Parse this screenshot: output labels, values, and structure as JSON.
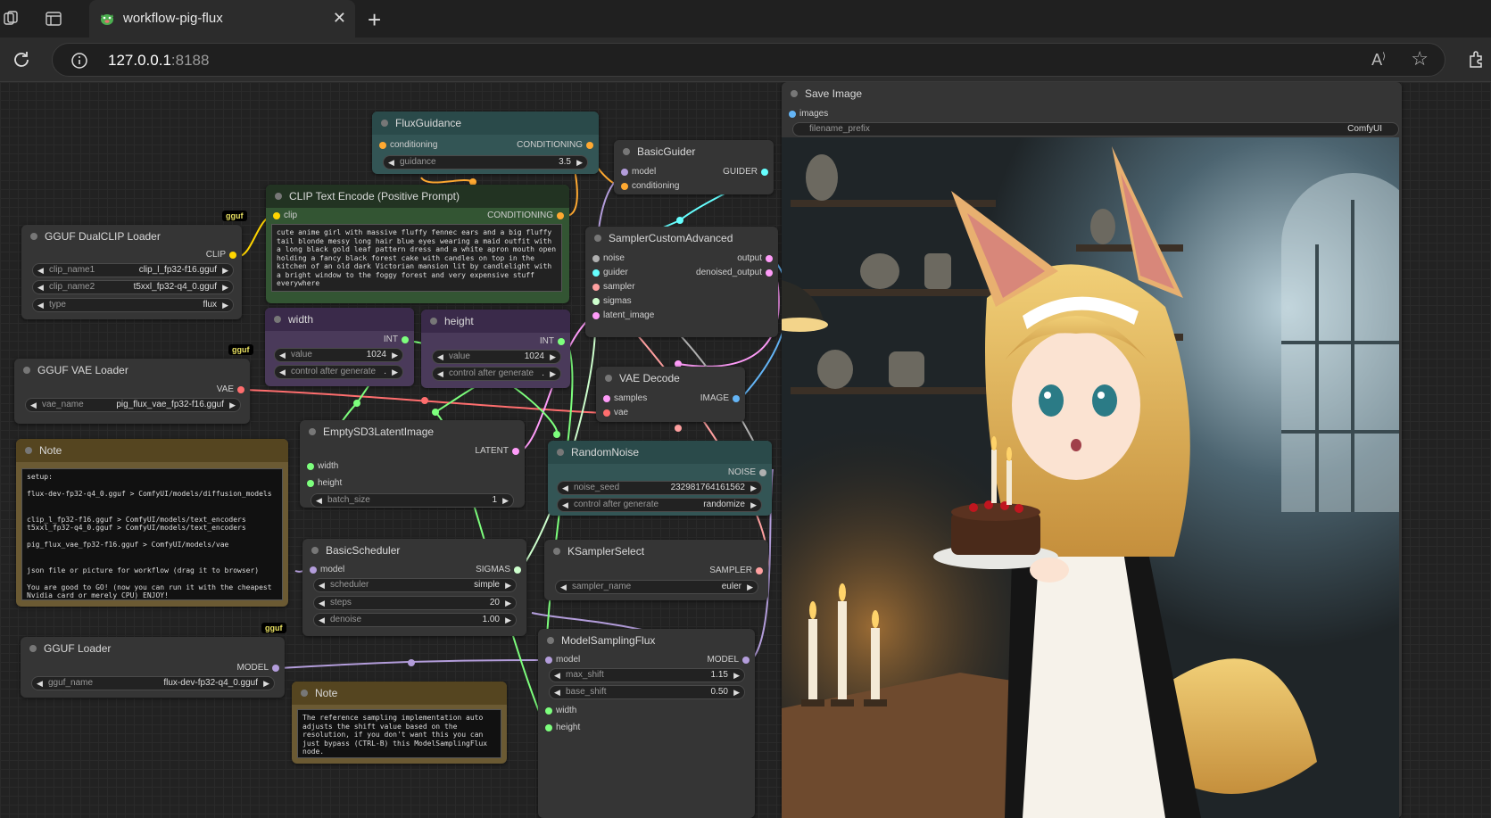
{
  "browser": {
    "tab_title": "workflow-pig-flux",
    "url_host": "127.0.0.1",
    "url_port": ":8188"
  },
  "colors": {
    "conditioning": "#ffa931",
    "clip": "#ffd500",
    "vae": "#ff6e6e",
    "latent": "#ff9cf9",
    "model": "#b39ddb",
    "int": "#7dff7d",
    "guider": "#66ffff",
    "image": "#64b5f6"
  },
  "nodes": {
    "flux_guidance": {
      "title": "FluxGuidance",
      "in_conditioning": "conditioning",
      "out_conditioning": "CONDITIONING",
      "guidance_label": "guidance",
      "guidance_value": "3.5"
    },
    "basic_guider": {
      "title": "BasicGuider",
      "in_model": "model",
      "in_conditioning": "conditioning",
      "out_guider": "GUIDER"
    },
    "clip_text_encode": {
      "title": "CLIP Text Encode (Positive Prompt)",
      "in_clip": "clip",
      "out_conditioning": "CONDITIONING",
      "text": "cute anime girl with massive fluffy fennec ears and a big fluffy tail blonde messy long hair blue eyes wearing a maid outfit with a long black gold leaf pattern dress and a white apron mouth open holding a fancy black forest cake with candles on top in the kitchen of an old dark Victorian mansion lit by candlelight with a bright window to the foggy forest and very expensive stuff everywhere"
    },
    "dualclip_loader": {
      "title": "GGUF DualCLIP Loader",
      "badge": "gguf",
      "out_clip": "CLIP",
      "clip_name1_label": "clip_name1",
      "clip_name1_value": "clip_l_fp32-f16.gguf",
      "clip_name2_label": "clip_name2",
      "clip_name2_value": "t5xxl_fp32-q4_0.gguf",
      "type_label": "type",
      "type_value": "flux"
    },
    "sampler_custom_advanced": {
      "title": "SamplerCustomAdvanced",
      "in_noise": "noise",
      "in_guider": "guider",
      "in_sampler": "sampler",
      "in_sigmas": "sigmas",
      "in_latent_image": "latent_image",
      "out_output": "output",
      "out_denoised_output": "denoised_output"
    },
    "width": {
      "title": "width",
      "out_int": "INT",
      "value_label": "value",
      "value": "1024",
      "control_label": "control after generate",
      "control_value": "."
    },
    "height": {
      "title": "height",
      "out_int": "INT",
      "value_label": "value",
      "value": "1024",
      "control_label": "control after generate",
      "control_value": "."
    },
    "vae_loader": {
      "title": "GGUF VAE Loader",
      "badge": "gguf",
      "out_vae": "VAE",
      "vae_name_label": "vae_name",
      "vae_name_value": "pig_flux_vae_fp32-f16.gguf"
    },
    "vae_decode": {
      "title": "VAE Decode",
      "in_samples": "samples",
      "in_vae": "vae",
      "out_image": "IMAGE"
    },
    "note1": {
      "title": "Note",
      "text": "setup:\n\nflux-dev-fp32-q4_0.gguf > ComfyUI/models/diffusion_models\n\n\nclip_l_fp32-f16.gguf > ComfyUI/models/text_encoders\nt5xxl_fp32-q4_0.gguf > ComfyUI/models/text_encoders\n\npig_flux_vae_fp32-f16.gguf > ComfyUI/models/vae\n\n\njson file or picture for workflow (drag it to browser)\n\nYou are good to GO! (now you can run it with the cheapest Nvidia card or merely CPU) ENJOY!"
    },
    "empty_latent": {
      "title": "EmptySD3LatentImage",
      "in_width": "width",
      "in_height": "height",
      "out_latent": "LATENT",
      "batch_label": "batch_size",
      "batch_value": "1"
    },
    "random_noise": {
      "title": "RandomNoise",
      "out_noise": "NOISE",
      "seed_label": "noise_seed",
      "seed_value": "232981764161562",
      "control_label": "control after generate",
      "control_value": "randomize"
    },
    "basic_scheduler": {
      "title": "BasicScheduler",
      "in_model": "model",
      "out_sigmas": "SIGMAS",
      "scheduler_label": "scheduler",
      "scheduler_value": "simple",
      "steps_label": "steps",
      "steps_value": "20",
      "denoise_label": "denoise",
      "denoise_value": "1.00"
    },
    "ksampler_select": {
      "title": "KSamplerSelect",
      "out_sampler": "SAMPLER",
      "sampler_label": "sampler_name",
      "sampler_value": "euler"
    },
    "gguf_loader": {
      "title": "GGUF Loader",
      "badge": "gguf",
      "out_model": "MODEL",
      "gguf_label": "gguf_name",
      "gguf_value": "flux-dev-fp32-q4_0.gguf"
    },
    "note2": {
      "title": "Note",
      "text": "The reference sampling implementation auto adjusts the shift value based on the resolution, if you don't want this you can just bypass (CTRL-B) this ModelSamplingFlux node."
    },
    "model_sampling_flux": {
      "title": "ModelSamplingFlux",
      "in_model": "model",
      "out_model": "MODEL",
      "max_shift_label": "max_shift",
      "max_shift_value": "1.15",
      "base_shift_label": "base_shift",
      "base_shift_value": "0.50",
      "in_width": "width",
      "in_height": "height"
    },
    "save_image": {
      "title": "Save Image",
      "in_images": "images",
      "prefix_label": "filename_prefix",
      "prefix_value": "ComfyUI"
    }
  }
}
